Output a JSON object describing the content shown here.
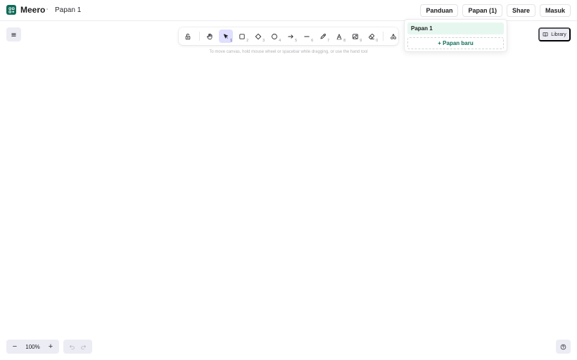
{
  "header": {
    "brand_name": "Meero",
    "board_title": "Papan 1",
    "actions": {
      "guide": "Panduan",
      "boards": "Papan (1)",
      "share": "Share",
      "login": "Masuk"
    }
  },
  "toolbar": {
    "tools": [
      {
        "name": "lock",
        "key": ""
      },
      {
        "name": "hand",
        "key": ""
      },
      {
        "name": "selection",
        "key": "1",
        "active": true
      },
      {
        "name": "rectangle",
        "key": "2"
      },
      {
        "name": "diamond",
        "key": "3"
      },
      {
        "name": "ellipse",
        "key": "4"
      },
      {
        "name": "arrow",
        "key": "5"
      },
      {
        "name": "line",
        "key": "6"
      },
      {
        "name": "draw",
        "key": "7"
      },
      {
        "name": "text",
        "key": "8"
      },
      {
        "name": "image",
        "key": "9"
      },
      {
        "name": "eraser",
        "key": "0"
      },
      {
        "name": "more-tools",
        "key": ""
      }
    ],
    "hint": "To move canvas, hold mouse wheel or spacebar while dragging, or use the hand tool"
  },
  "library": {
    "label": "Library"
  },
  "boards_dropdown": {
    "items": [
      "Papan 1"
    ],
    "new_board": "+ Papan baru"
  },
  "footer": {
    "zoom_out": "−",
    "zoom_level": "100%",
    "zoom_in": "+"
  },
  "colors": {
    "brand": "#0f6b58",
    "active_tool": "#e0dfff",
    "selected_board": "#e6f7ef"
  }
}
